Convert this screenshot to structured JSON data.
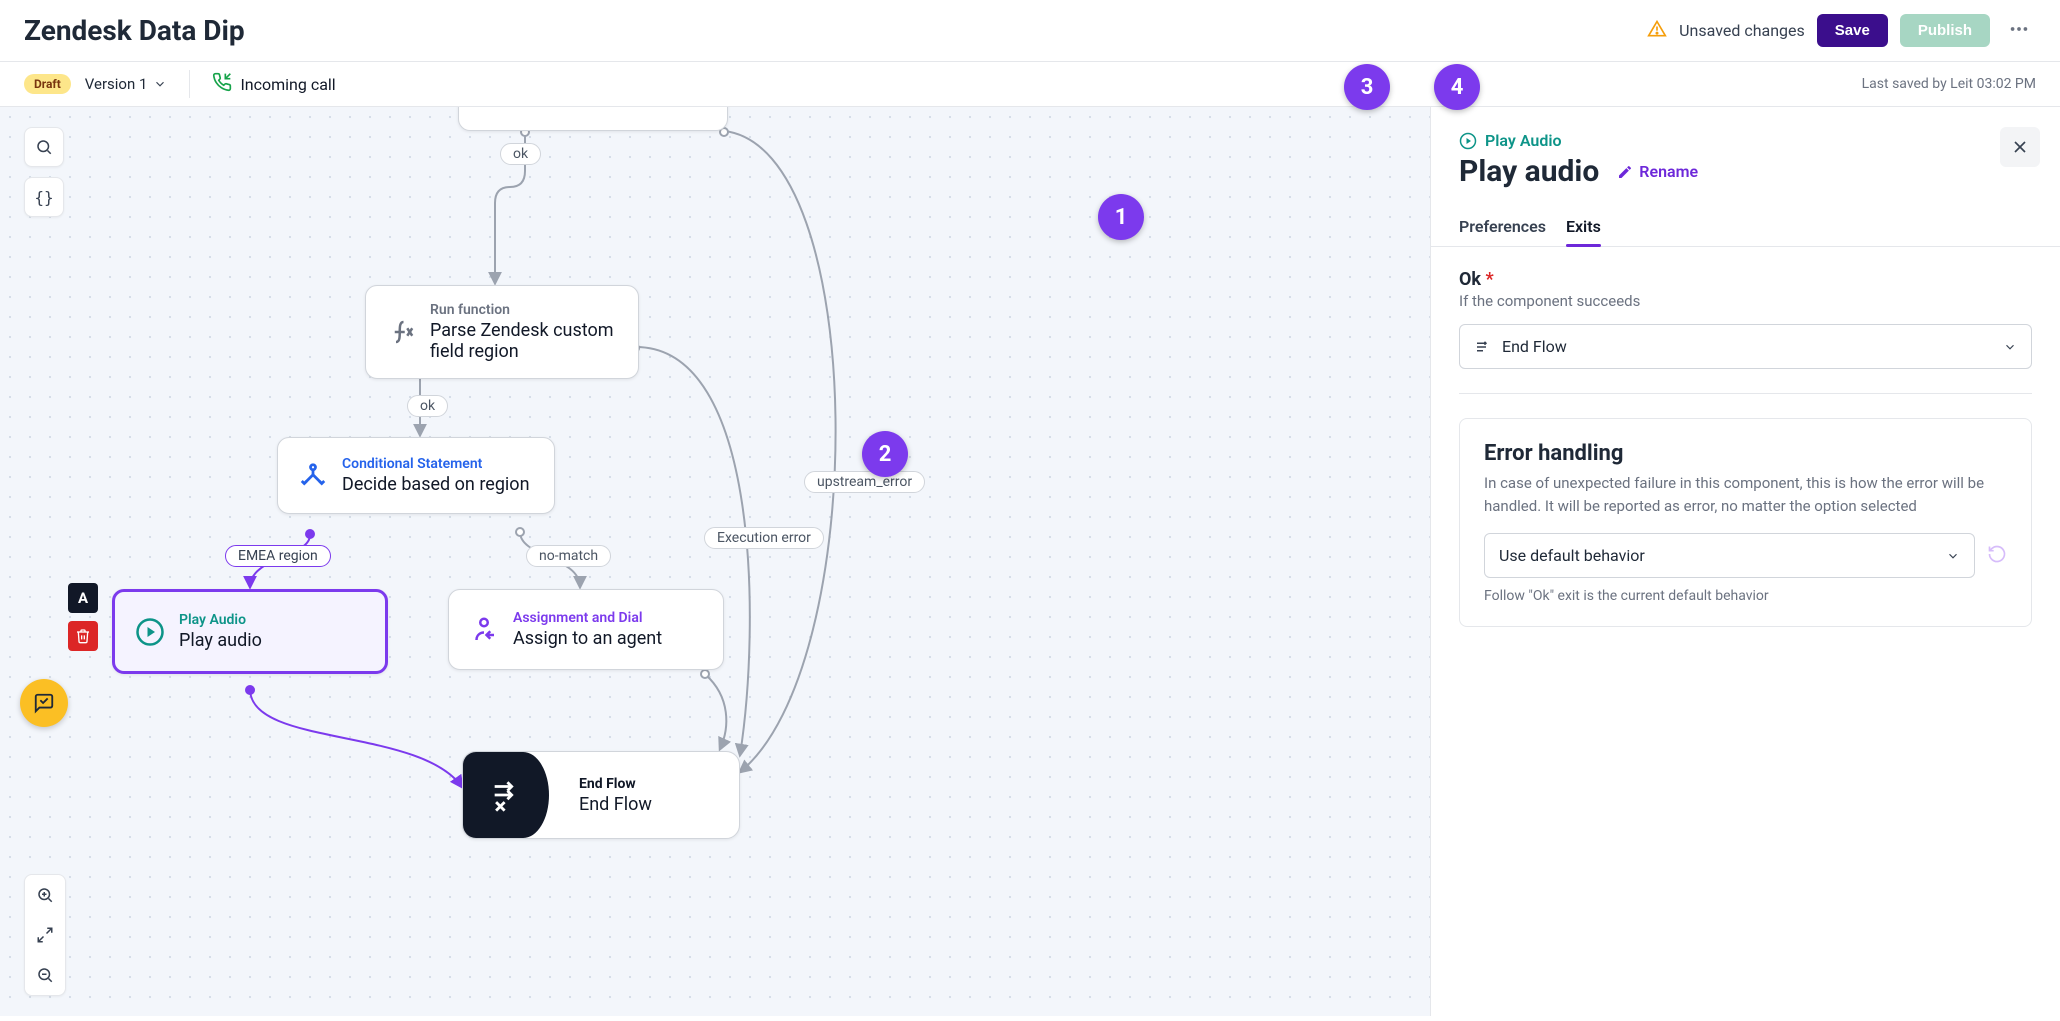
{
  "header": {
    "title": "Zendesk Data Dip",
    "unsaved": "Unsaved changes",
    "save": "Save",
    "publish": "Publish"
  },
  "subheader": {
    "draft": "Draft",
    "version": "Version 1",
    "incoming": "Incoming call",
    "last_saved": "Last saved by            Leit          03:02 PM"
  },
  "nodes": {
    "func": {
      "type": "Run function",
      "title": "Parse Zendesk custom field region"
    },
    "cond": {
      "type": "Conditional Statement",
      "title": "Decide based on region"
    },
    "play": {
      "type": "Play Audio",
      "title": "Play audio"
    },
    "assign": {
      "type": "Assignment and Dial",
      "title": "Assign to an agent"
    },
    "end": {
      "type": "End Flow",
      "title": "End Flow"
    }
  },
  "edges": {
    "ok1": "ok",
    "ok2": "ok",
    "emea": "EMEA region",
    "nomatch": "no-match",
    "exec_err": "Execution error",
    "upstream": "upstream_error"
  },
  "panel": {
    "eyebrow": "Play Audio",
    "title": "Play audio",
    "rename": "Rename",
    "tabs": {
      "preferences": "Preferences",
      "exits": "Exits"
    },
    "ok_label": "Ok",
    "ok_help": "If the component succeeds",
    "ok_value": "End Flow",
    "err_title": "Error handling",
    "err_help": "In case of unexpected failure in this component, this is how the error will be handled. It will be reported as error, no matter the option selected",
    "err_value": "Use default behavior",
    "err_foot": "Follow \"Ok\" exit is the current default behavior"
  },
  "annotations": {
    "a1": "1",
    "a2": "2",
    "a3": "3",
    "a4": "4"
  }
}
